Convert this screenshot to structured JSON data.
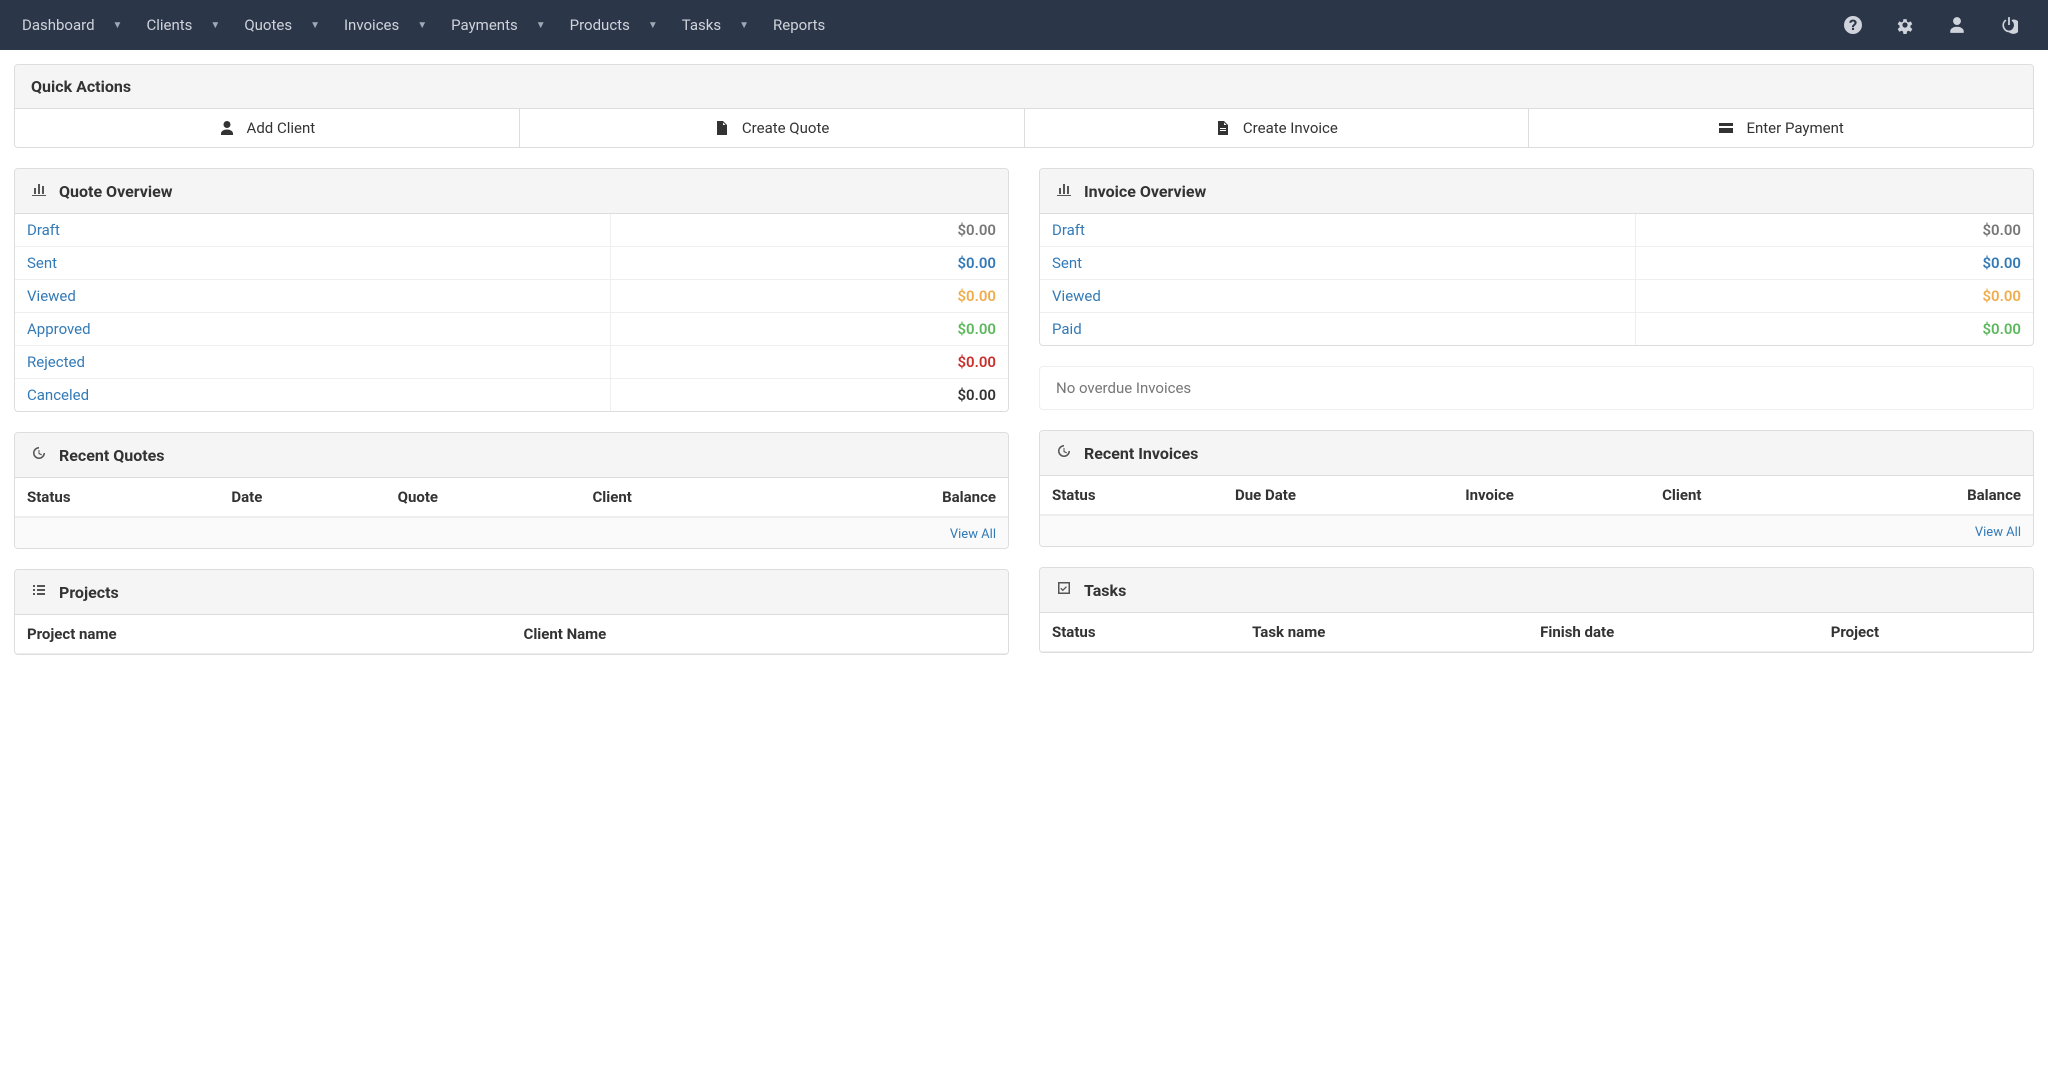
{
  "nav": {
    "items": [
      "Dashboard",
      "Clients",
      "Quotes",
      "Invoices",
      "Payments",
      "Products",
      "Tasks",
      "Reports"
    ]
  },
  "quick_actions": {
    "title": "Quick Actions",
    "add_client": "Add Client",
    "create_quote": "Create Quote",
    "create_invoice": "Create Invoice",
    "enter_payment": "Enter Payment"
  },
  "quote_overview": {
    "title": "Quote Overview",
    "rows": [
      {
        "label": "Draft",
        "amount": "$0.00",
        "cls": "amt-gray"
      },
      {
        "label": "Sent",
        "amount": "$0.00",
        "cls": "amt-blue"
      },
      {
        "label": "Viewed",
        "amount": "$0.00",
        "cls": "amt-orange"
      },
      {
        "label": "Approved",
        "amount": "$0.00",
        "cls": "amt-green"
      },
      {
        "label": "Rejected",
        "amount": "$0.00",
        "cls": "amt-red"
      },
      {
        "label": "Canceled",
        "amount": "$0.00",
        "cls": "amt-dark"
      }
    ]
  },
  "invoice_overview": {
    "title": "Invoice Overview",
    "rows": [
      {
        "label": "Draft",
        "amount": "$0.00",
        "cls": "amt-gray"
      },
      {
        "label": "Sent",
        "amount": "$0.00",
        "cls": "amt-blue"
      },
      {
        "label": "Viewed",
        "amount": "$0.00",
        "cls": "amt-orange"
      },
      {
        "label": "Paid",
        "amount": "$0.00",
        "cls": "amt-green"
      }
    ]
  },
  "overdue_alert": "No overdue Invoices",
  "recent_quotes": {
    "title": "Recent Quotes",
    "headers": [
      "Status",
      "Date",
      "Quote",
      "Client",
      "Balance"
    ],
    "view_all": "View All"
  },
  "recent_invoices": {
    "title": "Recent Invoices",
    "headers": [
      "Status",
      "Due Date",
      "Invoice",
      "Client",
      "Balance"
    ],
    "view_all": "View All"
  },
  "projects": {
    "title": "Projects",
    "headers": [
      "Project name",
      "Client Name"
    ]
  },
  "tasks": {
    "title": "Tasks",
    "headers": [
      "Status",
      "Task name",
      "Finish date",
      "Project"
    ]
  }
}
